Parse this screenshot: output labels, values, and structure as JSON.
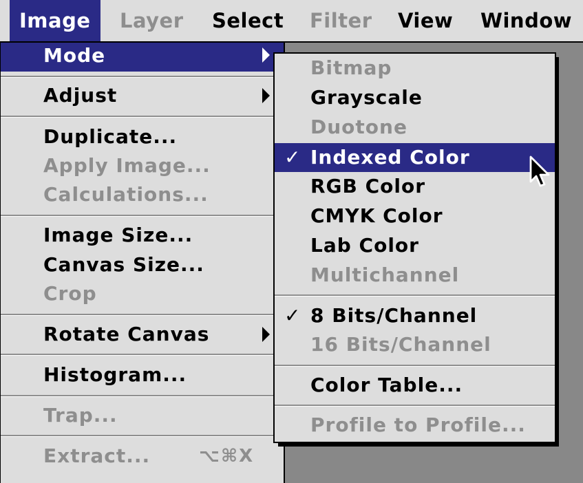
{
  "menubar": {
    "items": [
      {
        "label": "Image",
        "state": "active"
      },
      {
        "label": "Layer",
        "state": "disabled"
      },
      {
        "label": "Select",
        "state": "enabled"
      },
      {
        "label": "Filter",
        "state": "disabled"
      },
      {
        "label": "View",
        "state": "enabled"
      },
      {
        "label": "Window",
        "state": "enabled"
      }
    ]
  },
  "image_menu": {
    "items": [
      {
        "label": "Mode",
        "state": "highlighted",
        "submenu": true
      },
      {
        "label": "Adjust",
        "state": "enabled",
        "submenu": true
      },
      {
        "label": "Duplicate...",
        "state": "enabled"
      },
      {
        "label": "Apply Image...",
        "state": "disabled"
      },
      {
        "label": "Calculations...",
        "state": "disabled"
      },
      {
        "label": "Image Size...",
        "state": "enabled"
      },
      {
        "label": "Canvas Size...",
        "state": "enabled"
      },
      {
        "label": "Crop",
        "state": "disabled"
      },
      {
        "label": "Rotate Canvas",
        "state": "enabled",
        "submenu": true
      },
      {
        "label": "Histogram...",
        "state": "enabled"
      },
      {
        "label": "Trap...",
        "state": "disabled"
      },
      {
        "label": "Extract...",
        "state": "disabled",
        "shortcut": "⌥⌘X"
      }
    ]
  },
  "mode_submenu": {
    "items": [
      {
        "label": "Bitmap",
        "state": "disabled"
      },
      {
        "label": "Grayscale",
        "state": "enabled"
      },
      {
        "label": "Duotone",
        "state": "disabled"
      },
      {
        "label": "Indexed Color",
        "state": "highlighted",
        "checked": true
      },
      {
        "label": "RGB Color",
        "state": "enabled"
      },
      {
        "label": "CMYK Color",
        "state": "enabled"
      },
      {
        "label": "Lab Color",
        "state": "enabled"
      },
      {
        "label": "Multichannel",
        "state": "disabled"
      },
      {
        "label": "8 Bits/Channel",
        "state": "enabled",
        "checked": true
      },
      {
        "label": "16 Bits/Channel",
        "state": "disabled"
      },
      {
        "label": "Color Table...",
        "state": "enabled"
      },
      {
        "label": "Profile to Profile...",
        "state": "disabled"
      }
    ],
    "check_mark": "✓"
  },
  "colors": {
    "highlight": "#2a2a86",
    "menu_bg": "#dddddd",
    "disabled_text": "#8e8e8e"
  }
}
